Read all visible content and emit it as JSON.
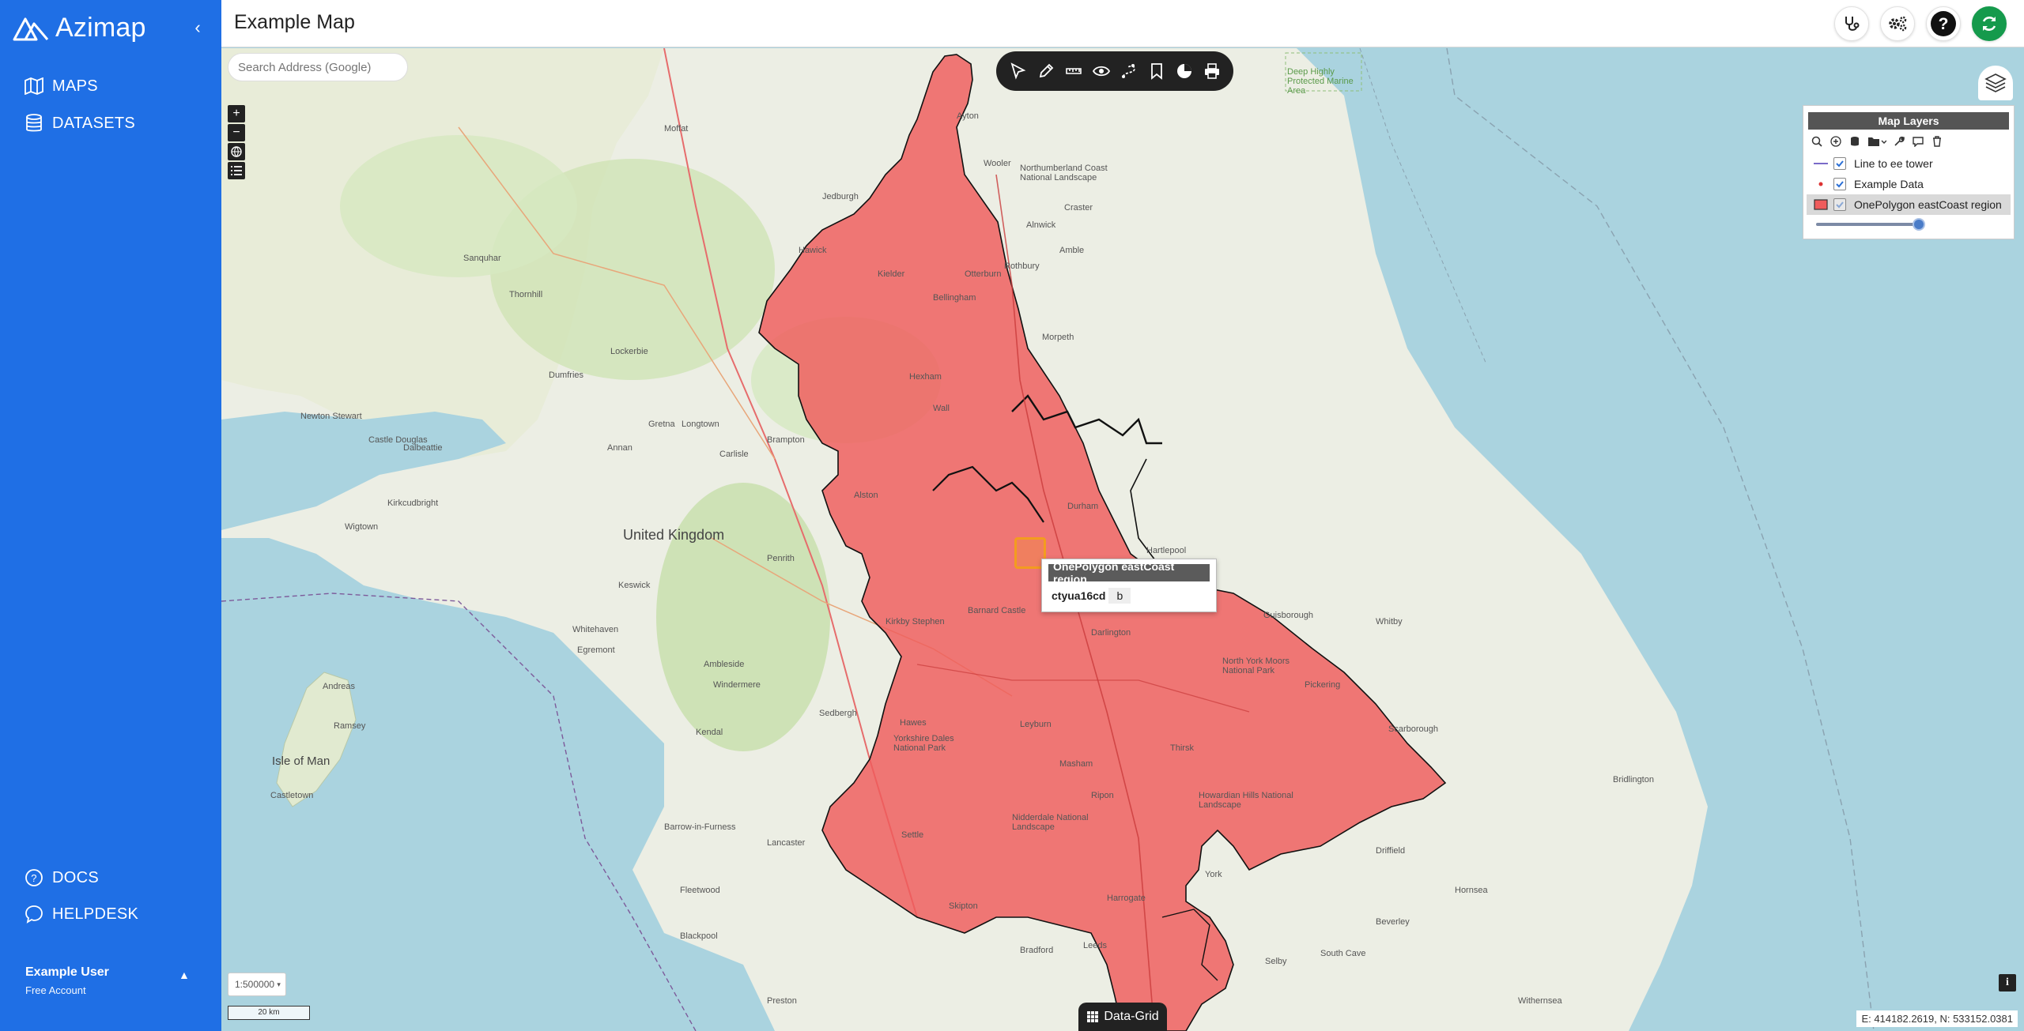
{
  "app": {
    "name": "Azimap"
  },
  "sidebar": {
    "nav": [
      {
        "label": "MAPS",
        "icon": "map-icon"
      },
      {
        "label": "DATASETS",
        "icon": "database-icon"
      }
    ],
    "bottom_nav": [
      {
        "label": "DOCS",
        "icon": "help-circle-icon"
      },
      {
        "label": "HELPDESK",
        "icon": "chat-icon"
      }
    ],
    "user": {
      "name": "Example User",
      "plan": "Free Account"
    }
  },
  "header": {
    "title": "Example Map"
  },
  "map": {
    "search_placeholder": "Search Address (Google)",
    "places": {
      "uk": "United Kingdom",
      "iom": "Isle of Man",
      "carlisle": "Carlisle",
      "york": "York",
      "durham": "Durham",
      "darlington": "Darlington",
      "kendal": "Kendal",
      "dumfries": "Dumfries",
      "keswick": "Keswick",
      "sedbergh": "Sedbergh",
      "whitby": "Whitby",
      "scarborough": "Scarborough",
      "hexham": "Hexham",
      "penrith": "Penrith",
      "ripon": "Ripon",
      "lockerbie": "Lockerbie",
      "jedburgh": "Jedburgh",
      "morpeth": "Morpeth",
      "bradford": "Bradford",
      "leeds": "Leeds",
      "driffield": "Driffield",
      "beverley": "Beverley",
      "blackpool": "Blackpool",
      "preston": "Preston",
      "lancaster": "Lancaster",
      "moffat": "Moffat",
      "wigtown": "Wigtown",
      "andreas": "Andreas",
      "ramsey": "Ramsey",
      "castletown": "Castletown",
      "whitehaven": "Whitehaven",
      "egremont": "Egremont",
      "windermere": "Windermere",
      "ambleside": "Ambleside",
      "barrow": "Barrow-in-Furness",
      "fleetwood": "Fleetwood",
      "harrogate": "Harrogate",
      "thirsk": "Thirsk",
      "selby": "Selby",
      "hornsea": "Hornsea",
      "withernsea": "Withernsea",
      "south_cave": "South Cave",
      "bridlington": "Bridlington",
      "pickering": "Pickering",
      "guisborough": "Guisborough",
      "hartlepool": "Hartlepool",
      "yorkshire_dales": "Yorkshire Dales National Park",
      "nidderdale": "Nidderdale National Landscape",
      "howardian": "Howardian Hills National Landscape",
      "north_york_moors": "North York Moors National Park",
      "northumberland_coast": "Northumberland Coast National Landscape",
      "marine_area": "Deep Highly Protected Marine Area",
      "alston": "Alston",
      "wall": "Wall",
      "longtown": "Longtown",
      "annan": "Annan",
      "gretna": "Gretna",
      "brampton": "Brampton",
      "kirkby_stephen": "Kirkby Stephen",
      "barnard_castle": "Barnard Castle",
      "leyburn": "Leyburn",
      "hawes": "Hawes",
      "masham": "Masham",
      "settle": "Settle",
      "skipton": "Skipton",
      "dalbeattie": "Dalbeattie",
      "kirkcudbright": "Kirkcudbright",
      "castle_douglas": "Castle Douglas",
      "newton_stewart": "Newton Stewart",
      "thornhill": "Thornhill",
      "sanquhar": "Sanquhar",
      "hawick": "Hawick",
      "alnwick": "Alnwick",
      "rothbury": "Rothbury",
      "bellingham": "Bellingham",
      "kielder": "Kielder",
      "otterburn": "Otterburn",
      "craster": "Craster",
      "amble": "Amble",
      "wooler": "Wooler",
      "ayton": "Ayton"
    },
    "scale": "1:500000",
    "scale_bar": "20 km",
    "coords": "E: 414182.2619, N: 533152.0381",
    "data_grid": "Data-Grid",
    "popup": {
      "title": "OnePolygon eastCoast region",
      "key": "ctyua16cd",
      "value": "b"
    },
    "region_color": "#ef5b5b"
  },
  "layers_panel": {
    "title": "Map Layers",
    "layers": [
      {
        "name": "Line to ee tower",
        "checked": true
      },
      {
        "name": "Example Data",
        "checked": true
      },
      {
        "name": "OnePolygon eastCoast region",
        "checked": true
      }
    ],
    "opacity": 0.95
  }
}
